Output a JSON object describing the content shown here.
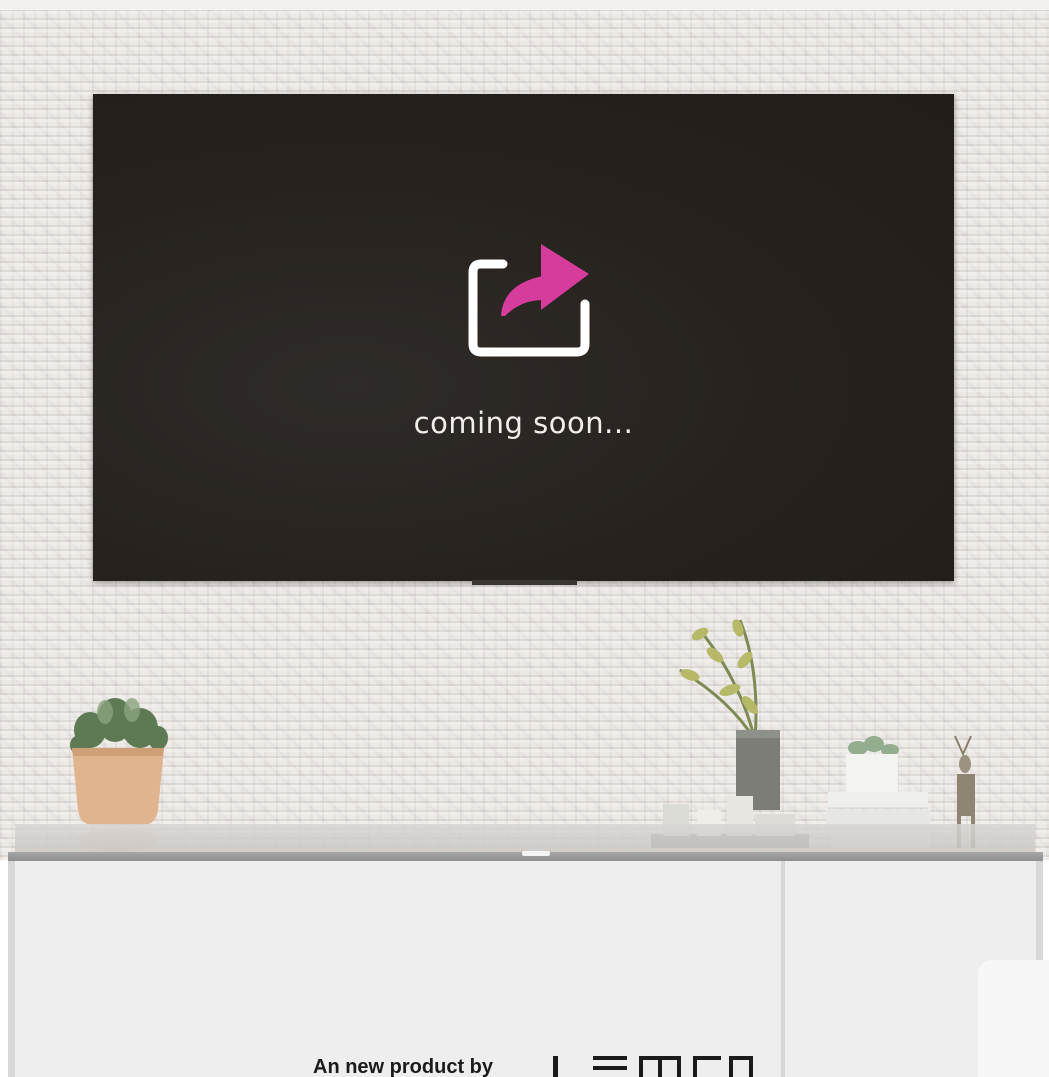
{
  "screen": {
    "message": "coming soon...",
    "icon": "share-icon",
    "colors": {
      "screen_bg": "#26211d",
      "accent": "#d63c9c",
      "text": "#f2eeeb",
      "wall": "#e9e5e2",
      "cabinet": "#eeeeee"
    }
  },
  "footer": {
    "tagline": "An new product by",
    "brand": "LEMCO"
  }
}
